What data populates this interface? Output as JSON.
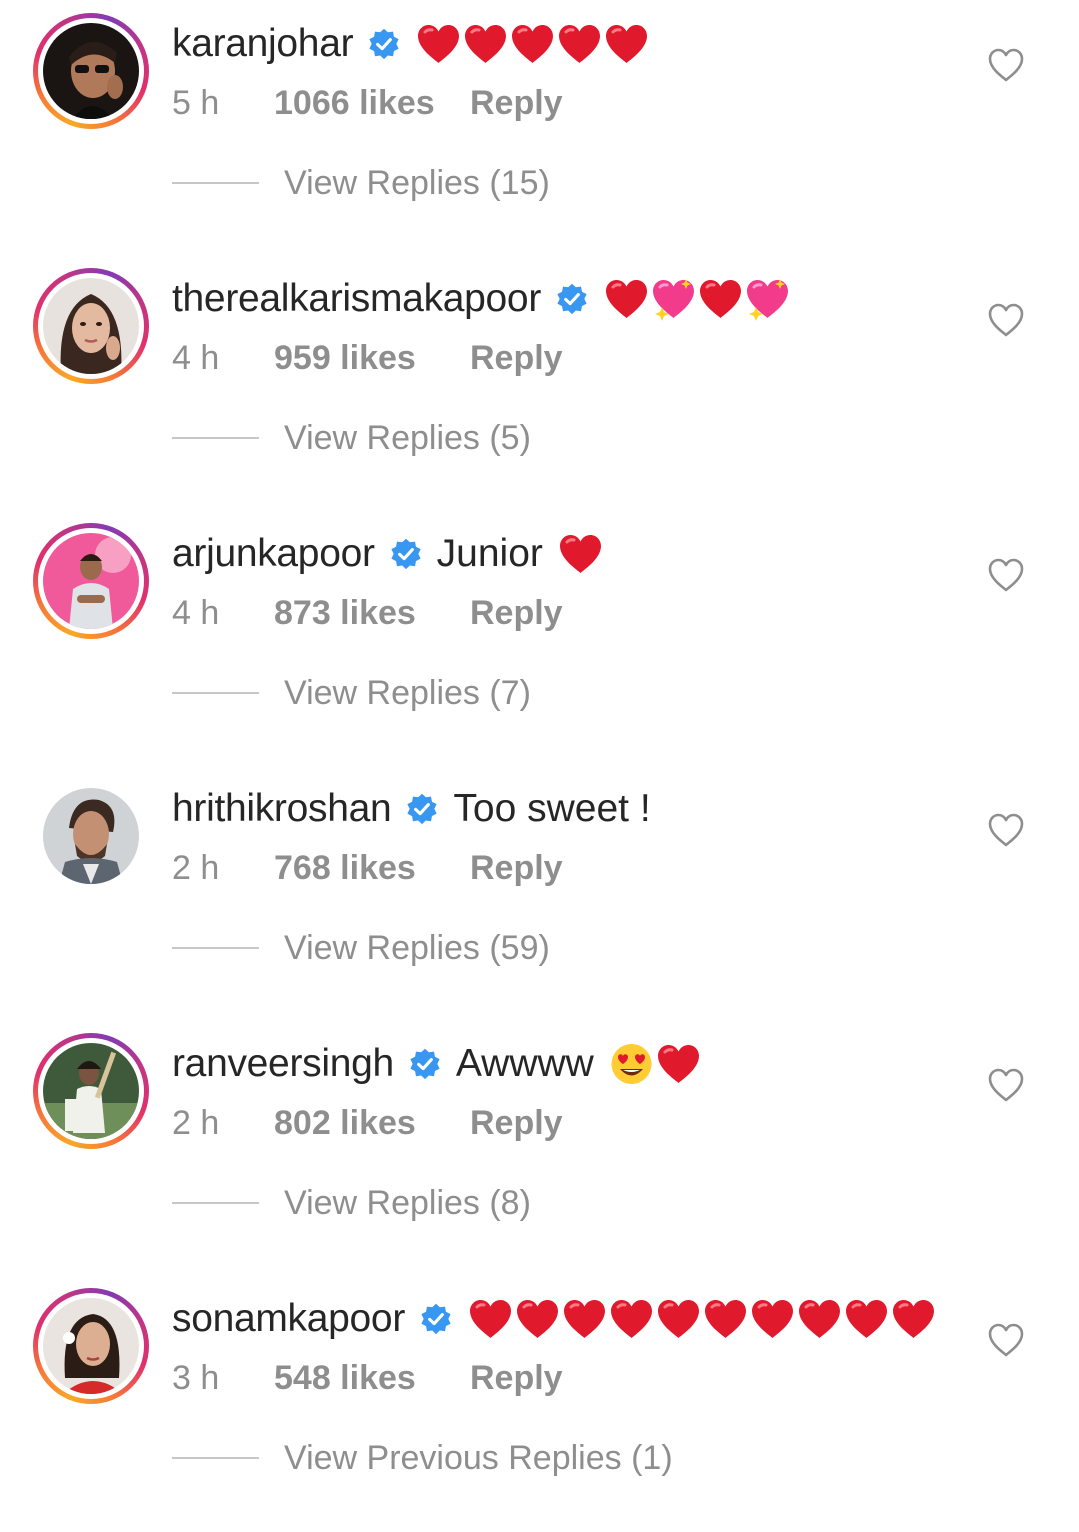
{
  "colors": {
    "text_primary": "#262626",
    "text_secondary": "#8e8e8e",
    "verified_blue": "#3897f0",
    "heart_red": "#e0192d",
    "divider": "#c7c7c7"
  },
  "comments": [
    {
      "username": "karanjohar",
      "verified": true,
      "text": "",
      "emojis": [
        "red-heart",
        "red-heart",
        "red-heart",
        "red-heart",
        "red-heart"
      ],
      "time": "5 h",
      "likes": "1066 likes",
      "reply_label": "Reply",
      "replies_label": "View Replies (15)",
      "story_ring": true
    },
    {
      "username": "therealkarismakapoor",
      "verified": true,
      "text": "",
      "emojis": [
        "red-heart",
        "sparkling-heart",
        "red-heart",
        "sparkling-heart"
      ],
      "time": "4 h",
      "likes": "959 likes",
      "reply_label": "Reply",
      "replies_label": "View Replies (5)",
      "story_ring": true
    },
    {
      "username": "arjunkapoor",
      "verified": true,
      "text": "Junior",
      "emojis": [
        "red-heart"
      ],
      "time": "4 h",
      "likes": "873 likes",
      "reply_label": "Reply",
      "replies_label": "View Replies (7)",
      "story_ring": true
    },
    {
      "username": "hrithikroshan",
      "verified": true,
      "text": "Too sweet !",
      "emojis": [],
      "time": "2 h",
      "likes": "768 likes",
      "reply_label": "Reply",
      "replies_label": "View Replies (59)",
      "story_ring": false
    },
    {
      "username": "ranveersingh",
      "verified": true,
      "text": "Awwww",
      "emojis": [
        "heart-eyes-face",
        "red-heart"
      ],
      "time": "2 h",
      "likes": "802 likes",
      "reply_label": "Reply",
      "replies_label": "View Replies (8)",
      "story_ring": true
    },
    {
      "username": "sonamkapoor",
      "verified": true,
      "text": "",
      "emojis": [
        "red-heart",
        "red-heart",
        "red-heart",
        "red-heart",
        "red-heart",
        "red-heart",
        "red-heart",
        "red-heart",
        "red-heart",
        "red-heart"
      ],
      "time": "3 h",
      "likes": "548 likes",
      "reply_label": "Reply",
      "replies_label": "View Previous Replies (1)",
      "story_ring": true
    }
  ]
}
